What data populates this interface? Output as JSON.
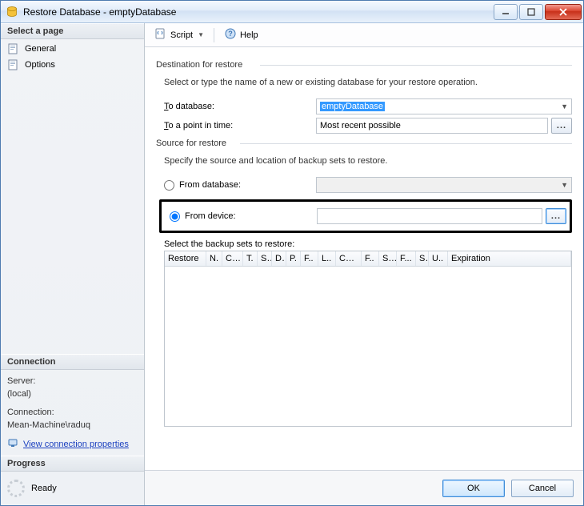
{
  "window": {
    "title": "Restore Database - emptyDatabase"
  },
  "sidebar": {
    "select_page_header": "Select a page",
    "pages": [
      {
        "label": "General"
      },
      {
        "label": "Options"
      }
    ],
    "connection_header": "Connection",
    "server_label": "Server:",
    "server_value": "(local)",
    "connection_label": "Connection:",
    "connection_value": "Mean-Machine\\raduq",
    "view_properties_link": "View connection properties",
    "progress_header": "Progress",
    "progress_status": "Ready"
  },
  "toolbar": {
    "script_label": "Script",
    "help_label": "Help"
  },
  "main": {
    "dest_header": "Destination for restore",
    "dest_help": "Select or type the name of a new or existing database for your restore operation.",
    "to_database_label_prefix": "T",
    "to_database_label_rest": "o database:",
    "to_database_value": "emptyDatabase",
    "to_point_label_prefix": "T",
    "to_point_label_rest": "o a point in time:",
    "to_point_value": "Most recent possible",
    "source_header": "Source for restore",
    "source_help": "Specify the source and location of backup sets to restore.",
    "from_database_label": "From database:",
    "from_database_value": "",
    "from_device_label": "From device:",
    "from_device_value": "",
    "backup_sets_label": "Select the backup sets to restore:",
    "table_columns": [
      "Restore",
      "N.",
      "C...",
      "T.",
      "S.",
      "D.",
      "P.",
      "F..",
      "L..",
      "Ch...",
      "F..",
      "S..",
      "F...",
      "S",
      "U..",
      "Expiration"
    ]
  },
  "footer": {
    "ok_label": "OK",
    "cancel_label": "Cancel"
  }
}
